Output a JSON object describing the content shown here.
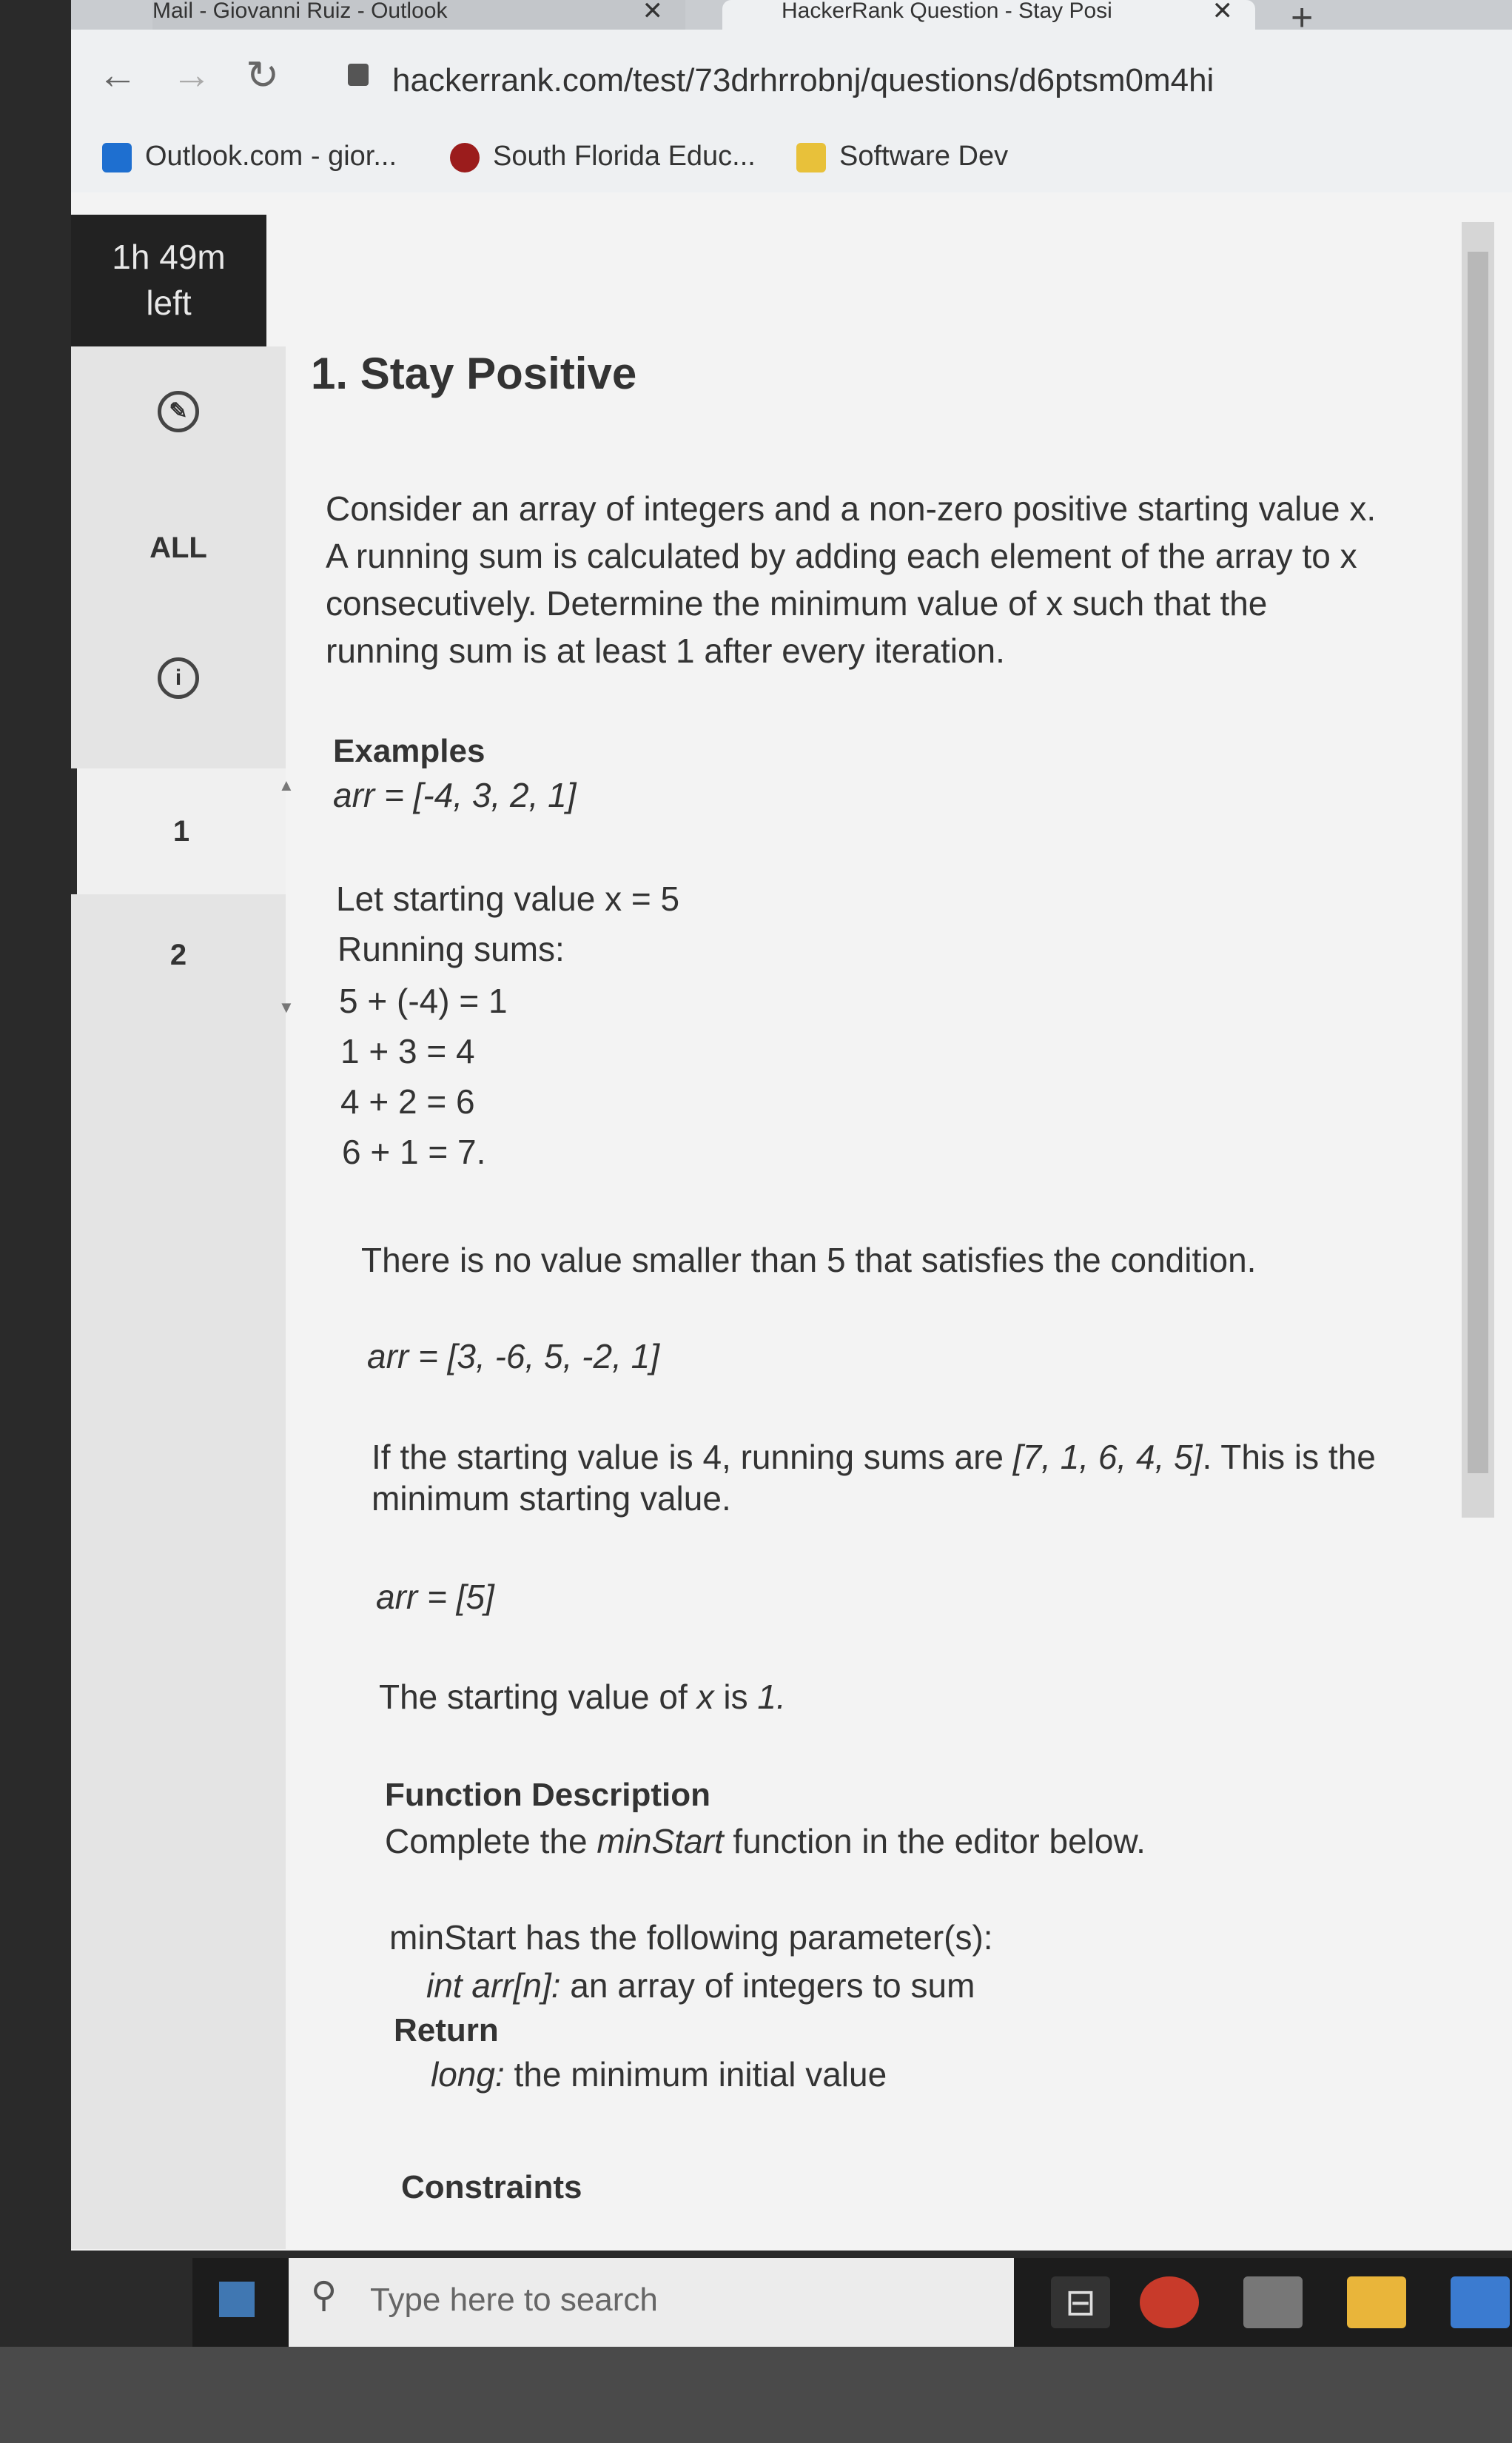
{
  "browser": {
    "tabs": [
      {
        "label": "Mail - Giovanni Ruiz - Outlook"
      },
      {
        "label": "HackerRank Question - Stay Posi"
      }
    ],
    "url": "hackerrank.com/test/73drhrrobnj/questions/d6ptsm0m4hi",
    "bookmarks": [
      "Outlook.com - gior...",
      "South Florida Educ...",
      "Software Dev"
    ]
  },
  "sidebar": {
    "timer_line1": "1h 49m",
    "timer_line2": "left",
    "all_label": "ALL",
    "questions": [
      "1",
      "2"
    ]
  },
  "question": {
    "title": "1. Stay Positive",
    "intro": "Consider an array of integers and a non-zero positive starting value x. A running sum is calculated by adding each element of the array to x consecutively. Determine the minimum value of x such that the running sum is at least 1 after every iteration.",
    "examples_heading": "Examples",
    "ex1_arr": "arr = [-4, 3, 2, 1]",
    "ex1_start": "Let starting value x = 5",
    "ex1_running": "Running sums:",
    "ex1_sums": [
      "5 + (-4) = 1",
      "1 + 3 = 4",
      "4 + 2 = 6",
      "6 + 1 = 7."
    ],
    "ex1_note": "There is no value smaller than 5 that satisfies the condition.",
    "ex2_arr": "arr = [3, -6, 5, -2, 1]",
    "ex2_note_pre": "If the starting value is 4, running sums are ",
    "ex2_note_list": "[7, 1, 6, 4, 5]",
    "ex2_note_post": ". This is the minimum starting value.",
    "ex3_arr": "arr = [5]",
    "ex3_note_pre": "The starting value of ",
    "ex3_note_var": "x",
    "ex3_note_mid": " is ",
    "ex3_note_val": "1.",
    "fd_heading": "Function Description",
    "fd_pre": "Complete the ",
    "fd_func": "minStart",
    "fd_post": " function in the editor below.",
    "params_line": "minStart has the following parameter(s):",
    "param_name": "int arr[n]:",
    "param_desc": " an array of integers to sum",
    "return_heading": "Return",
    "return_type": "long:",
    "return_desc": " the minimum initial value",
    "constraints_heading": "Constraints"
  },
  "taskbar": {
    "search_placeholder": "Type here to search"
  }
}
